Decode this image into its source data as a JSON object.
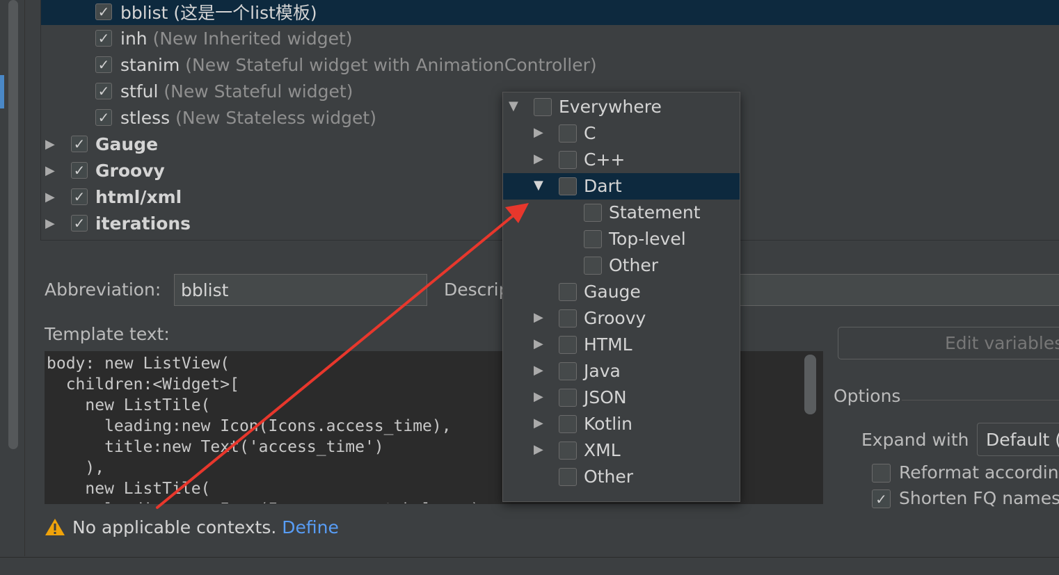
{
  "templates": {
    "items": [
      {
        "abbr": "bblist",
        "desc": "(这是一个list模板)",
        "checked": true,
        "selected": true
      },
      {
        "abbr": "inh",
        "desc": "(New Inherited widget)",
        "checked": true
      },
      {
        "abbr": "stanim",
        "desc": "(New Stateful widget with AnimationController)",
        "checked": true
      },
      {
        "abbr": "stful",
        "desc": "(New Stateful widget)",
        "checked": true
      },
      {
        "abbr": "stless",
        "desc": "(New Stateless widget)",
        "checked": true
      }
    ],
    "groups": [
      {
        "label": "Gauge",
        "checked": true
      },
      {
        "label": "Groovy",
        "checked": true
      },
      {
        "label": "html/xml",
        "checked": true
      },
      {
        "label": "iterations",
        "checked": true
      }
    ]
  },
  "form": {
    "abbreviation_label": "Abbreviation:",
    "abbreviation_value": "bblist",
    "description_label": "Descrip",
    "template_text_label": "Template text:",
    "template_text": "body: new ListView(\n  children:<Widget>[\n    new ListTile(\n      leading:new Icon(Icons.access_time),\n      title:new Text('access_time')\n    ),\n    new ListTile(\n      leading:new Icon(Icons.account_balance),"
  },
  "right_panel": {
    "edit_variables_label": "Edit variables",
    "options_label": "Options",
    "expand_with_label": "Expand with",
    "expand_with_value": "Default (",
    "reformat_label": "Reformat according",
    "reformat_checked": false,
    "shorten_label": "Shorten FQ names",
    "shorten_checked": true
  },
  "warning": {
    "text": "No applicable contexts.",
    "link": "Define",
    "icon": "warning-icon"
  },
  "context_popup": {
    "items": [
      {
        "label": "Everywhere",
        "level": 0,
        "expander": "expanded"
      },
      {
        "label": "C",
        "level": 1,
        "expander": "collapsed"
      },
      {
        "label": "C++",
        "level": 1,
        "expander": "collapsed"
      },
      {
        "label": "Dart",
        "level": 1,
        "expander": "expanded",
        "selected": true
      },
      {
        "label": "Statement",
        "level": 2,
        "expander": "none"
      },
      {
        "label": "Top-level",
        "level": 2,
        "expander": "none"
      },
      {
        "label": "Other",
        "level": 2,
        "expander": "none"
      },
      {
        "label": "Gauge",
        "level": 1,
        "expander": "none"
      },
      {
        "label": "Groovy",
        "level": 1,
        "expander": "collapsed"
      },
      {
        "label": "HTML",
        "level": 1,
        "expander": "collapsed"
      },
      {
        "label": "Java",
        "level": 1,
        "expander": "collapsed"
      },
      {
        "label": "JSON",
        "level": 1,
        "expander": "collapsed"
      },
      {
        "label": "Kotlin",
        "level": 1,
        "expander": "collapsed"
      },
      {
        "label": "XML",
        "level": 1,
        "expander": "collapsed"
      },
      {
        "label": "Other",
        "level": 1,
        "expander": "none"
      }
    ]
  },
  "colors": {
    "background": "#3c3f41",
    "selection": "#0d293e",
    "link": "#589df6",
    "annotation_arrow": "#e8372c",
    "warning": "#f0a30a"
  }
}
